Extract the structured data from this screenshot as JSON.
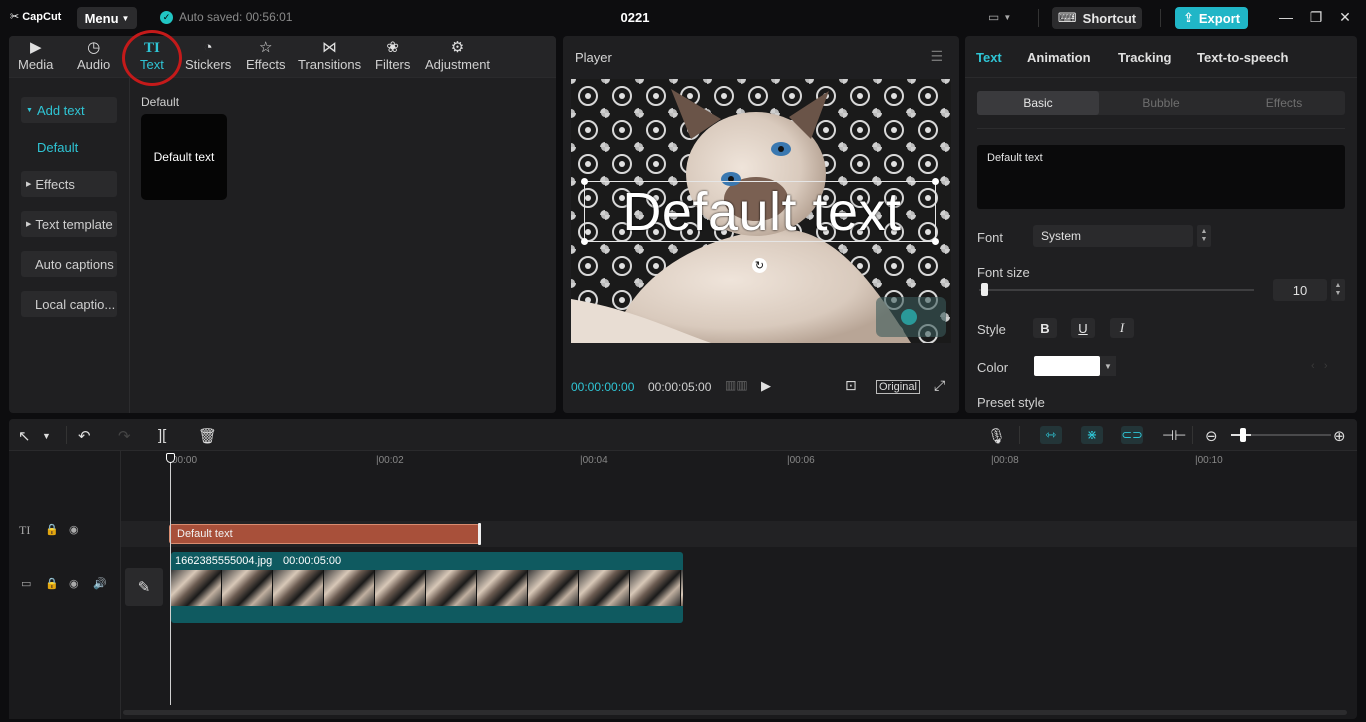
{
  "app": {
    "logo": "CapCut",
    "menu_label": "Menu",
    "autosave": "Auto saved: 00:56:01",
    "project_title": "0221",
    "shortcut_label": "Shortcut",
    "export_label": "Export"
  },
  "media_tabs": [
    {
      "label": "Media",
      "icon": "media-icon"
    },
    {
      "label": "Audio",
      "icon": "audio-icon"
    },
    {
      "label": "Text",
      "icon": "text-icon",
      "active": true
    },
    {
      "label": "Stickers",
      "icon": "stickers-icon"
    },
    {
      "label": "Effects",
      "icon": "effects-icon"
    },
    {
      "label": "Transitions",
      "icon": "transitions-icon"
    },
    {
      "label": "Filters",
      "icon": "filters-icon"
    },
    {
      "label": "Adjustment",
      "icon": "adjustment-icon"
    }
  ],
  "side_nav": {
    "add_text": "Add text",
    "default": "Default",
    "effects": "Effects",
    "text_template": "Text template",
    "auto_captions": "Auto captions",
    "local_captions": "Local captio..."
  },
  "text_library": {
    "section_label": "Default",
    "card_label": "Default text"
  },
  "player": {
    "title": "Player",
    "overlay_text": "Default text",
    "time_current": "00:00:00:00",
    "time_total": "00:00:05:00",
    "original_label": "Original"
  },
  "inspector": {
    "tabs": [
      "Text",
      "Animation",
      "Tracking",
      "Text-to-speech"
    ],
    "segments": [
      "Basic",
      "Bubble",
      "Effects"
    ],
    "text_value": "Default text",
    "font_label": "Font",
    "font_value": "System",
    "font_size_label": "Font size",
    "font_size_value": "10",
    "style_label": "Style",
    "style_buttons": [
      "B",
      "U",
      "I"
    ],
    "color_label": "Color",
    "color_value": "#ffffff",
    "preset_label": "Preset style"
  },
  "timeline": {
    "ruler": [
      "00:00",
      "00:02",
      "00:04",
      "00:06",
      "00:08",
      "00:10"
    ],
    "text_clip_label": "Default text",
    "video_clip_name": "1662385555004.jpg",
    "video_clip_duration": "00:00:05:00"
  },
  "colors": {
    "accent": "#2fc5d5",
    "export": "#20b6c7",
    "text_clip": "#a8503a",
    "video_clip": "#0f5a60",
    "highlight_circle": "#c41a1a"
  }
}
